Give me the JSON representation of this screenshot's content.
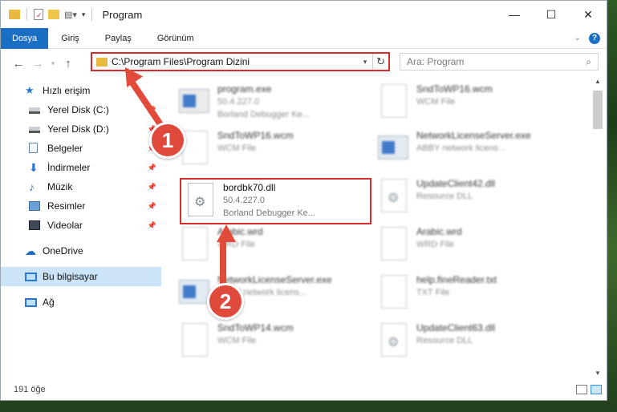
{
  "window": {
    "title": "Program"
  },
  "ribbon": {
    "tabs": [
      "Dosya",
      "Giriş",
      "Paylaş",
      "Görünüm"
    ]
  },
  "address": {
    "path": "C:\\Program Files\\Program Dizini"
  },
  "search": {
    "placeholder": "Ara: Program"
  },
  "sidebar": {
    "items": [
      {
        "label": "Hızlı erişim"
      },
      {
        "label": "Yerel Disk (C:)"
      },
      {
        "label": "Yerel Disk (D:)"
      },
      {
        "label": "Belgeler"
      },
      {
        "label": "İndirmeler"
      },
      {
        "label": "Müzik"
      },
      {
        "label": "Resimler"
      },
      {
        "label": "Videolar"
      },
      {
        "label": "OneDrive"
      },
      {
        "label": "Bu bilgisayar"
      },
      {
        "label": "Ağ"
      }
    ]
  },
  "files": [
    {
      "name": "program.exe",
      "line2": "50.4.227.0",
      "line3": "Borland Debugger Ke..."
    },
    {
      "name": "SndToWP16.wcm",
      "line2": "WCM File",
      "line3": ""
    },
    {
      "name": "SndToWP16.wcm",
      "line2": "WCM File",
      "line3": ""
    },
    {
      "name": "NetworkLicenseServer.exe",
      "line2": "ABBY network licens...",
      "line3": ""
    },
    {
      "name": "bordbk70.dll",
      "line2": "50.4.227.0",
      "line3": "Borland Debugger Ke..."
    },
    {
      "name": "UpdateClient42.dll",
      "line2": "Resource DLL",
      "line3": ""
    },
    {
      "name": "Arabic.wrd",
      "line2": "WRD File",
      "line3": ""
    },
    {
      "name": "Arabic.wrd",
      "line2": "WRD File",
      "line3": ""
    },
    {
      "name": "NetworkLicenseServer.exe",
      "line2": "ABBY network licens...",
      "line3": ""
    },
    {
      "name": "help.fineReader.txt",
      "line2": "TXT File",
      "line3": ""
    },
    {
      "name": "SndToWP14.wcm",
      "line2": "WCM File",
      "line3": ""
    },
    {
      "name": "UpdateClient63.dll",
      "line2": "Resource DLL",
      "line3": ""
    }
  ],
  "status": {
    "count": "191 öğe"
  },
  "annotations": {
    "step1": "1",
    "step2": "2"
  },
  "colors": {
    "accent": "#1a6fc4",
    "highlight": "#d62e2e",
    "badge": "#e04a3c"
  }
}
